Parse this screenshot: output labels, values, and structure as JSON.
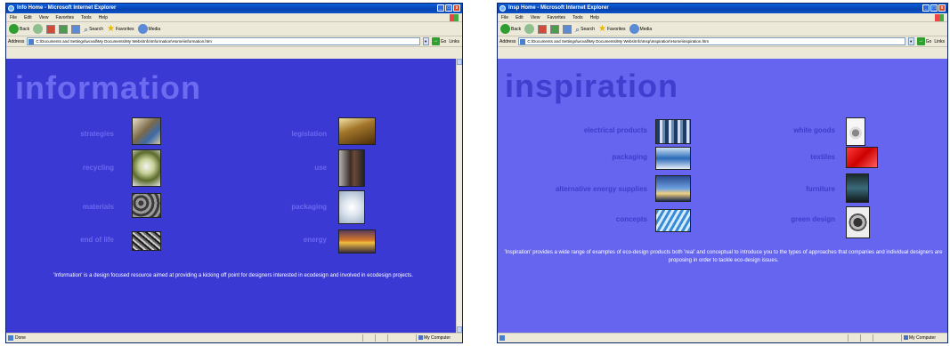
{
  "windows": [
    {
      "title": "Info Home - Microsoft Internet Explorer",
      "menu": [
        "File",
        "Edit",
        "View",
        "Favorites",
        "Tools",
        "Help"
      ],
      "toolbar": {
        "back": "Back",
        "search": "Search",
        "favorites": "Favorites",
        "media": "Media"
      },
      "address_label": "Address",
      "address": "C:\\Documents and Settings\\wcvall\\My Documents\\My Webs\\Info\\Information\\Home\\information.htm",
      "go": "Go",
      "links": "Links",
      "status": "Done",
      "zone": "My Computer",
      "heading": "information",
      "items": [
        {
          "label": "strategies"
        },
        {
          "label": "recycling"
        },
        {
          "label": "materials"
        },
        {
          "label": "end of life"
        },
        {
          "label": "legislation"
        },
        {
          "label": "use"
        },
        {
          "label": "packaging"
        },
        {
          "label": "energy"
        }
      ],
      "description": "'Information' is a design focused resource aimed at providing a kicking off point for designers interested in ecodesign and involved in ecodesign projects."
    },
    {
      "title": "Insp Home - Microsoft Internet Explorer",
      "menu": [
        "File",
        "Edit",
        "View",
        "Favorites",
        "Tools",
        "Help"
      ],
      "toolbar": {
        "back": "Back",
        "search": "Search",
        "favorites": "Favorites",
        "media": "Media"
      },
      "address_label": "Address",
      "address": "C:\\Documents and Settings\\wcvall\\My Documents\\My Webs\\Info\\Insp\\Inspiration\\Home\\inspiration.htm",
      "go": "Go",
      "links": "Links",
      "status": "",
      "zone": "My Computer",
      "heading": "inspiration",
      "items": [
        {
          "label": "electrical products"
        },
        {
          "label": "packaging"
        },
        {
          "label": "alternative energy supplies"
        },
        {
          "label": "concepts"
        },
        {
          "label": "white goods"
        },
        {
          "label": "textiles"
        },
        {
          "label": "furniture"
        },
        {
          "label": "green design"
        }
      ],
      "description": "'Inspiration' provides a wide range of examples of eco-design products both 'real' and conceptual to introduce you to the types of approaches that companies and individual designers are proposing in order to tackle eco-design issues."
    }
  ]
}
